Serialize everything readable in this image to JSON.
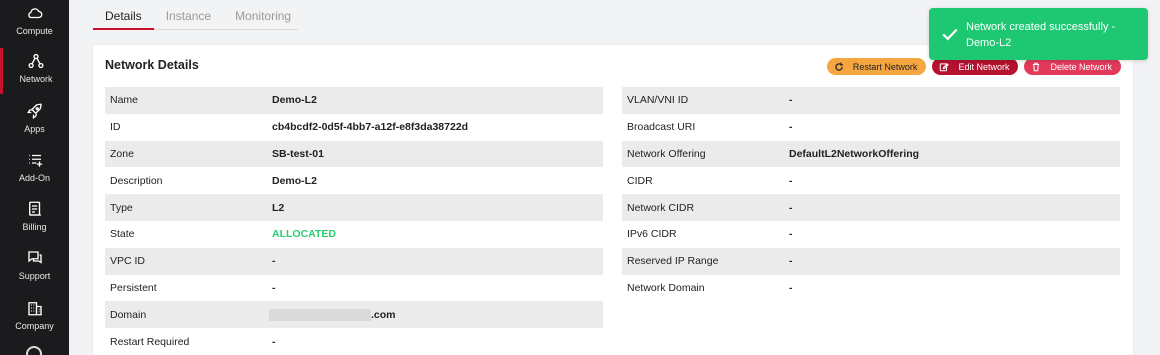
{
  "sidebar": {
    "items": [
      {
        "label": "Compute",
        "icon": "cloud-icon",
        "active": false
      },
      {
        "label": "Network",
        "icon": "network-icon",
        "active": true
      },
      {
        "label": "Apps",
        "icon": "rocket-icon",
        "active": false
      },
      {
        "label": "Add-On",
        "icon": "list-add-icon",
        "active": false
      },
      {
        "label": "Billing",
        "icon": "invoice-icon",
        "active": false
      },
      {
        "label": "Support",
        "icon": "chat-icon",
        "active": false
      },
      {
        "label": "Company",
        "icon": "building-icon",
        "active": false
      }
    ]
  },
  "tabs": [
    {
      "label": "Details",
      "active": true
    },
    {
      "label": "Instance",
      "active": false
    },
    {
      "label": "Monitoring",
      "active": false
    }
  ],
  "card": {
    "title": "Network Details",
    "actions": {
      "restart": "Restart Network",
      "edit": "Edit Network",
      "delete": "Delete Network"
    },
    "left": [
      {
        "key": "Name",
        "value": "Demo-L2"
      },
      {
        "key": "ID",
        "value": "cb4bcdf2-0d5f-4bb7-a12f-e8f3da38722d"
      },
      {
        "key": "Zone",
        "value": "SB-test-01"
      },
      {
        "key": "Description",
        "value": "Demo-L2"
      },
      {
        "key": "Type",
        "value": "L2"
      },
      {
        "key": "State",
        "value": "ALLOCATED"
      },
      {
        "key": "VPC ID",
        "value": "-"
      },
      {
        "key": "Persistent",
        "value": "-"
      },
      {
        "key": "Domain",
        "value": ".com"
      },
      {
        "key": "Restart Required",
        "value": "-"
      }
    ],
    "right": [
      {
        "key": "VLAN/VNI ID",
        "value": "-"
      },
      {
        "key": "Broadcast URI",
        "value": "-"
      },
      {
        "key": "Network Offering",
        "value": "DefaultL2NetworkOffering"
      },
      {
        "key": "CIDR",
        "value": "-"
      },
      {
        "key": "Network CIDR",
        "value": "-"
      },
      {
        "key": "IPv6 CIDR",
        "value": "-"
      },
      {
        "key": "Reserved IP Range",
        "value": "-"
      },
      {
        "key": "Network Domain",
        "value": "-"
      }
    ]
  },
  "toast": {
    "message": "Network created successfully - Demo-L2"
  },
  "colors": {
    "sidebar_bg": "#1b1b1d",
    "accent": "#c8102e",
    "restart": "#f5a640",
    "edit": "#b5122f",
    "delete": "#e23a5b",
    "success": "#1ec873",
    "state_text": "#2ecc71"
  }
}
